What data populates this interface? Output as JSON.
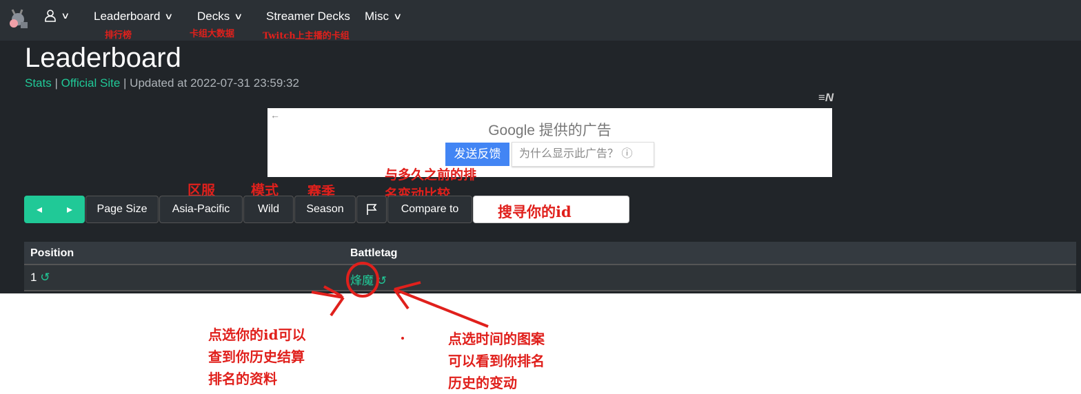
{
  "nav": {
    "items": [
      {
        "label": "Leaderboard"
      },
      {
        "label": "Decks"
      },
      {
        "label": "Streamer Decks"
      },
      {
        "label": "Misc"
      }
    ]
  },
  "page": {
    "title": "Leaderboard",
    "stats_link": "Stats",
    "official_link": "Official Site",
    "updated": "| Updated at 2022-07-31 23:59:32",
    "sep": "|"
  },
  "ad": {
    "back": "←",
    "brand": "Google",
    "brand_suffix": "提供的广告",
    "feedback": "发送反馈",
    "why": "为什么显示此广告？ ⓘ"
  },
  "toolbar": {
    "prev": "◂",
    "next": "▸",
    "page_size": "Page Size",
    "region": "Asia-Pacific",
    "mode": "Wild",
    "season": "Season",
    "compare": "Compare to",
    "search_value": ""
  },
  "table": {
    "headers": [
      "Position",
      "Battletag"
    ],
    "rows": [
      {
        "position": "1",
        "battletag": "烽魔"
      }
    ]
  },
  "annotations": {
    "leaderboard": "排行榜",
    "decks": "卡组大数据",
    "streamer": "Twitch上主播的卡组",
    "region": "区服",
    "mode": "模式",
    "season": "赛季",
    "compare": "与多久之前的排\n名变动比较",
    "search": "搜寻你的id",
    "click_id": "点选你的id可以\n查到你历史结算\n排名的资料",
    "click_time": "点选时间的图案\n可以看到你排名\n历史的变动"
  },
  "colors": {
    "accent": "#20c997",
    "annotation": "#e0201c",
    "background": "#212529"
  }
}
